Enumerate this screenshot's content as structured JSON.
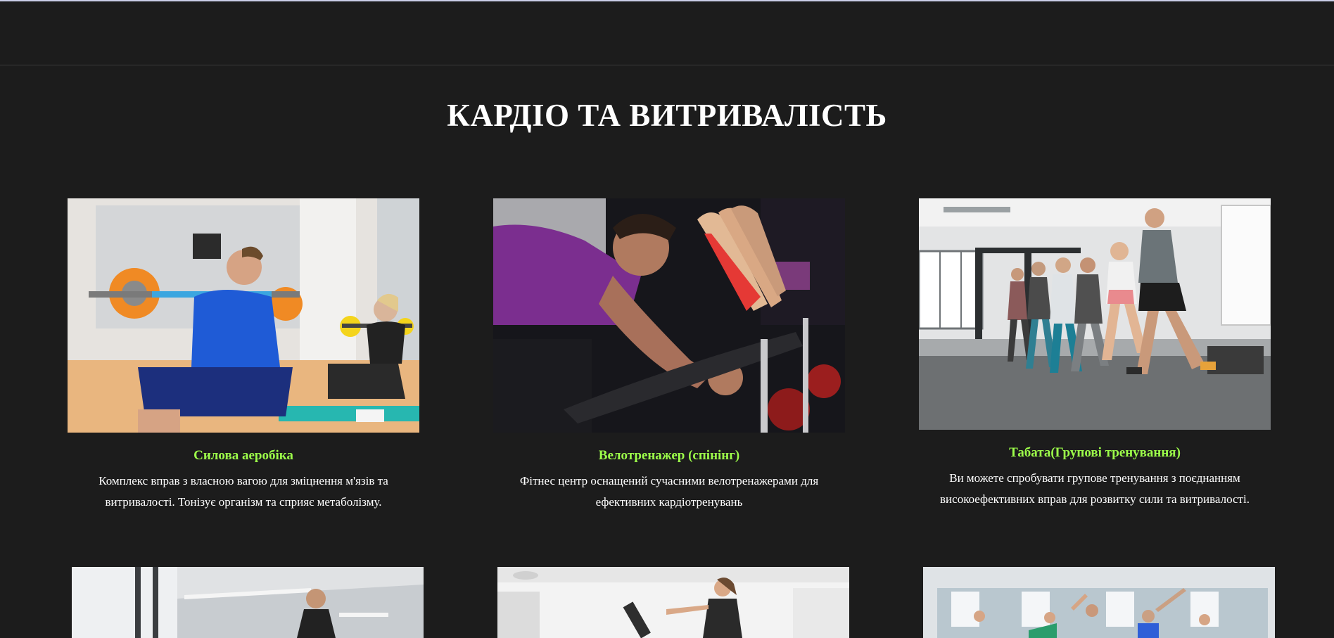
{
  "section": {
    "title": "КАРДІО ТА ВИТРИВАЛІСТЬ"
  },
  "cards": [
    {
      "title": "Силова аеробіка",
      "description": "Комплекс вправ з власною вагою для зміцнення м'язів та витривалості. Тонізує організм та сприяє метаболізму."
    },
    {
      "title": "Велотренажер (спінінг)",
      "description": "Фітнес центр оснащений сучасними велотренажерами для ефективних кардіотренувань"
    },
    {
      "title": "Табата(Групові тренування)",
      "description": "Ви можете спробувати групове тренування з поєднанням високоефективних вправ для розвитку сили та витривалості."
    }
  ],
  "colors": {
    "background": "#1c1c1c",
    "accent": "#9dff4a",
    "text": "#ffffff"
  }
}
